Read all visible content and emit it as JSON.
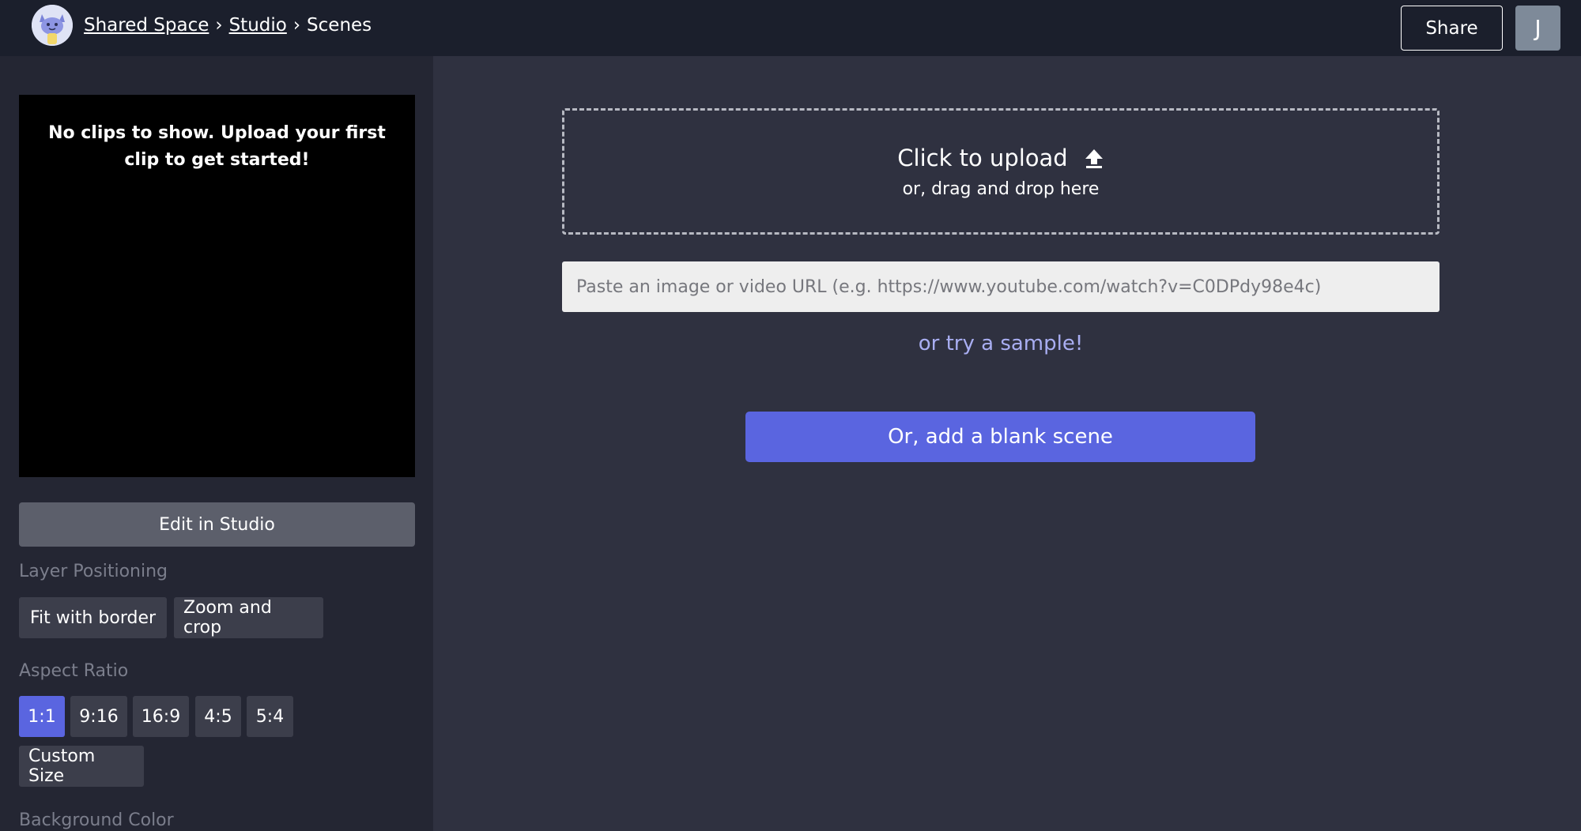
{
  "header": {
    "logo_icon": "cat-logo-icon",
    "breadcrumb": [
      "Shared Space",
      "Studio",
      "Scenes"
    ],
    "separator": "›",
    "share_label": "Share",
    "avatar_initial": "J"
  },
  "sidebar": {
    "preview_message": "No clips to show. Upload your first clip to get started!",
    "edit_label": "Edit in Studio",
    "layer_positioning": {
      "label": "Layer Positioning",
      "options": [
        "Fit with border",
        "Zoom and crop"
      ]
    },
    "aspect_ratio": {
      "label": "Aspect Ratio",
      "options": [
        "1:1",
        "9:16",
        "16:9",
        "4:5",
        "5:4"
      ],
      "selected": "1:1",
      "custom_label": "Custom Size"
    },
    "background_color_label": "Background Color"
  },
  "main": {
    "upload": {
      "title": "Click to upload",
      "icon": "upload-arrow-icon",
      "subtitle": "or, drag and drop here"
    },
    "url_placeholder": "Paste an image or video URL (e.g. https://www.youtube.com/watch?v=C0DPdy98e4c)",
    "sample_label": "or try a sample!",
    "blank_scene_label": "Or, add a blank scene"
  },
  "colors": {
    "accent": "#5a65e0",
    "topbar": "#1b1f2c",
    "sidebar": "#242633",
    "main": "#2f3140",
    "link": "#a9aef2"
  }
}
